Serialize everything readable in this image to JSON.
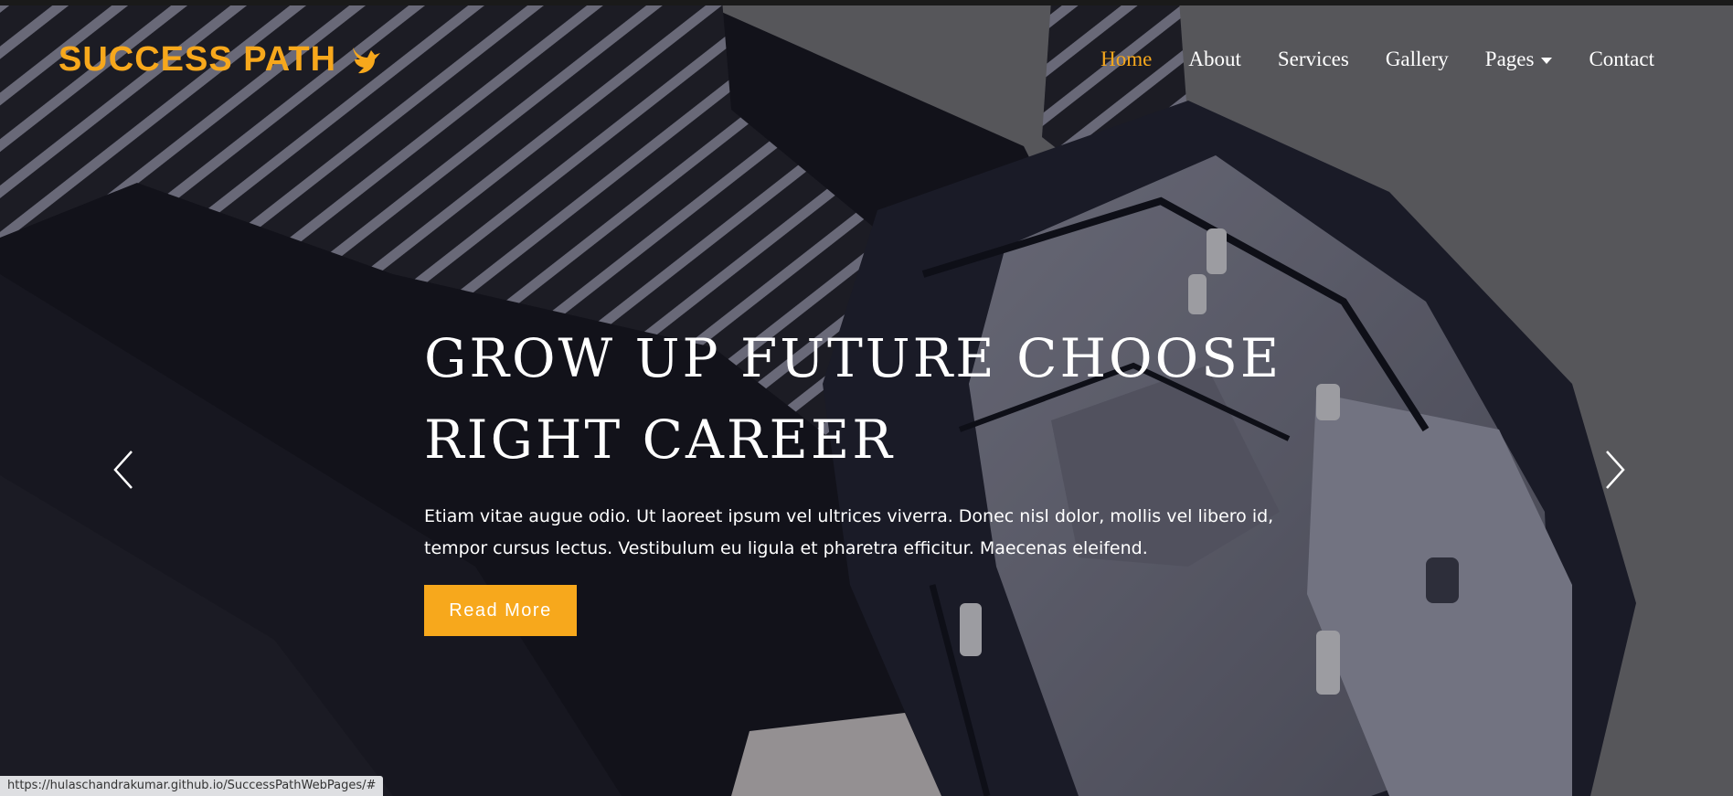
{
  "brand": {
    "name": "SUCCESS PATH",
    "icon": "bird-icon",
    "color": "#f7a81c"
  },
  "nav": {
    "items": [
      {
        "label": "Home",
        "active": true
      },
      {
        "label": "About"
      },
      {
        "label": "Services"
      },
      {
        "label": "Gallery"
      },
      {
        "label": "Pages",
        "dropdown": true
      },
      {
        "label": "Contact"
      }
    ]
  },
  "hero": {
    "headline_line1": "GROW UP FUTURE CHOOSE",
    "headline_line2": "RIGHT CAREER",
    "description": "Etiam vitae augue odio. Ut laoreet ipsum vel ultrices viverra. Donec nisl dolor, mollis vel libero id, tempor cursus lectus. Vestibulum eu ligula et pharetra efficitur. Maecenas eleifend.",
    "button_label": "Read More",
    "prev_icon": "chevron-left-icon",
    "next_icon": "chevron-right-icon"
  },
  "status_bar": {
    "url": "https://hulaschandrakumar.github.io/SuccessPathWebPages/#"
  },
  "colors": {
    "accent": "#f7a81c",
    "text": "#ffffff"
  }
}
